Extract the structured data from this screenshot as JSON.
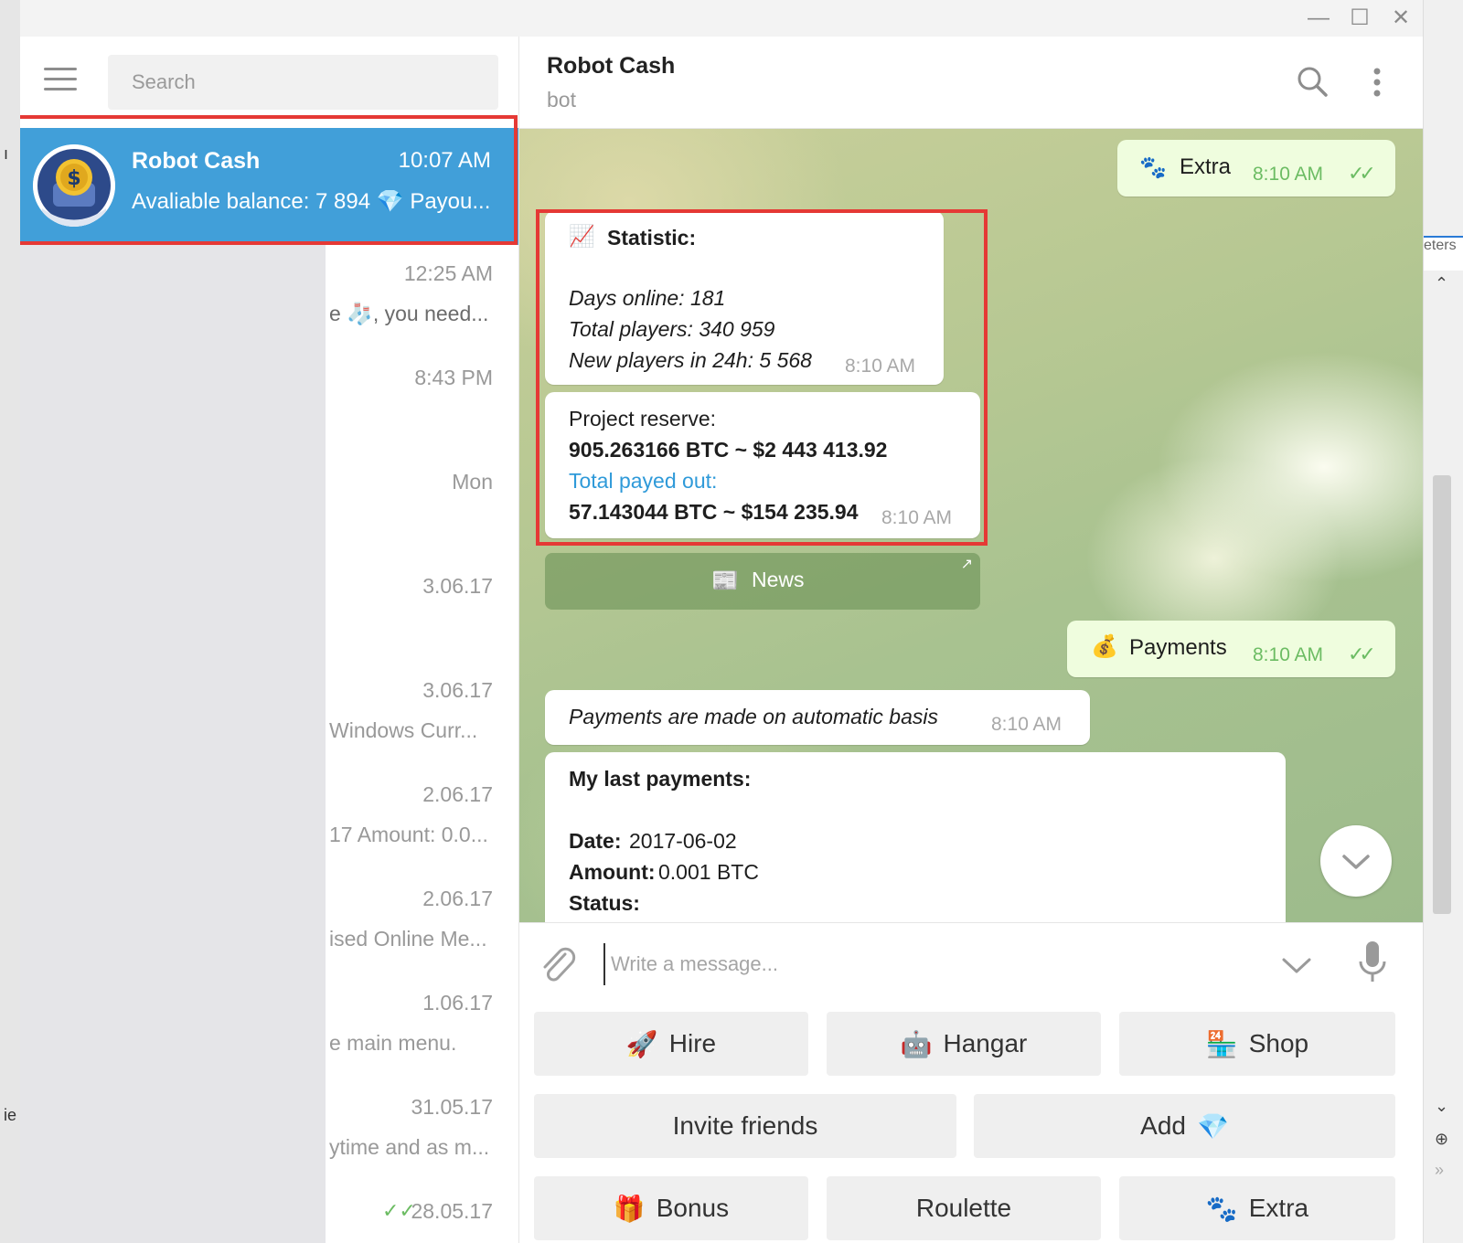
{
  "window": {
    "minimize": "—",
    "maximize": "☐",
    "close": "✕"
  },
  "sidebar": {
    "search_placeholder": "Search",
    "active_chat": {
      "name": "Robot Cash",
      "time": "10:07 AM",
      "preview": "Avaliable balance: 7 894 💎 Payou..."
    },
    "items": [
      {
        "time": "12:25 AM",
        "preview": "e 🧦, you need..."
      },
      {
        "time": "8:43 PM",
        "preview": ""
      },
      {
        "time": "Mon",
        "preview": ""
      },
      {
        "time": "3.06.17",
        "preview": ""
      },
      {
        "time": "3.06.17",
        "preview": "Windows Curr..."
      },
      {
        "time": "2.06.17",
        "preview": "17 Amount: 0.0..."
      },
      {
        "time": "2.06.17",
        "preview": "ised Online Me..."
      },
      {
        "time": "1.06.17",
        "preview": "e main menu."
      },
      {
        "time": "31.05.17",
        "preview": "ytime and as m..."
      },
      {
        "time": "28.05.17",
        "preview": ""
      }
    ],
    "last_checkmark": "✓✓"
  },
  "chat": {
    "title": "Robot Cash",
    "subtitle": "bot",
    "messages": {
      "extra_out": {
        "text": "Extra",
        "time": "8:10 AM",
        "check": "✓✓"
      },
      "statistic": {
        "heading": "Statistic:",
        "line1": "Days online: 181",
        "line2": "Total players: 340 959",
        "line3": "New players in 24h: 5 568",
        "time": "8:10 AM"
      },
      "reserve": {
        "label": "Project reserve:",
        "value": "905.263166 BTC ~ $2 443 413.92",
        "payed_label": "Total payed out:",
        "payed_value": "57.143044 BTC ~ $154 235.94",
        "time": "8:10 AM"
      },
      "news_button": {
        "label": "News",
        "arrow": "↗"
      },
      "payments_out": {
        "text": "Payments",
        "time": "8:10 AM",
        "check": "✓✓"
      },
      "auto": {
        "text": "Payments are made on automatic basis",
        "time": "8:10 AM"
      },
      "last_payments": {
        "heading": "My last payments:",
        "date_label": "Date:",
        "date_value": "2017-06-02",
        "amount_label": "Amount:",
        "amount_value": "0.001 BTC",
        "status_label": "Status:"
      }
    },
    "composer_placeholder": "Write a message..."
  },
  "keyboard": {
    "row1": [
      {
        "emoji": "🚀",
        "label": "Hire"
      },
      {
        "emoji": "🤖",
        "label": "Hangar"
      },
      {
        "emoji": "🏪",
        "label": "Shop"
      }
    ],
    "row2": [
      {
        "emoji": "",
        "label": "Invite friends"
      },
      {
        "emoji": "💎",
        "label": "Add"
      }
    ],
    "row3": [
      {
        "emoji": "🎁",
        "label": "Bonus"
      },
      {
        "emoji": "",
        "label": "Roulette"
      },
      {
        "emoji": "🐾",
        "label": "Extra"
      }
    ]
  },
  "background_window": {
    "tab_label": "eters"
  },
  "colors": {
    "accent": "#419fd9",
    "highlight": "#e53935",
    "out_bubble": "#effdde",
    "check": "#6cbc63"
  }
}
